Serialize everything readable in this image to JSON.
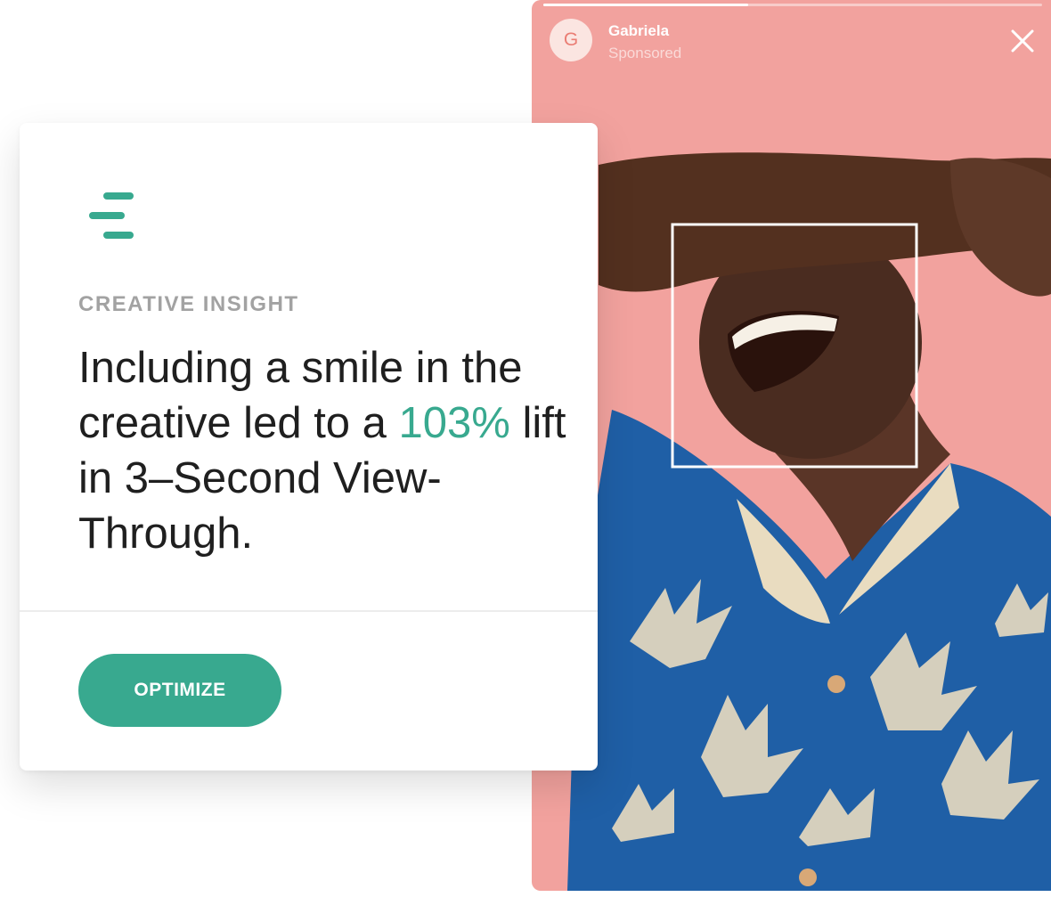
{
  "story": {
    "progress_fraction": 0.41,
    "avatar_initial": "G",
    "account_name": "Gabriela",
    "sponsored_label": "Sponsored"
  },
  "card": {
    "eyebrow": "CREATIVE INSIGHT",
    "headline_part1": "Including a smile in the creative led to a ",
    "headline_highlight": "103%",
    "headline_part2": " lift in 3–Second View-Through.",
    "optimize_label": "OPTIMIZE"
  },
  "colors": {
    "accent": "#38a98f",
    "story_background": "#f2a29e"
  },
  "icons": {
    "card_logo": "brand-bars-icon",
    "close": "close-icon"
  }
}
